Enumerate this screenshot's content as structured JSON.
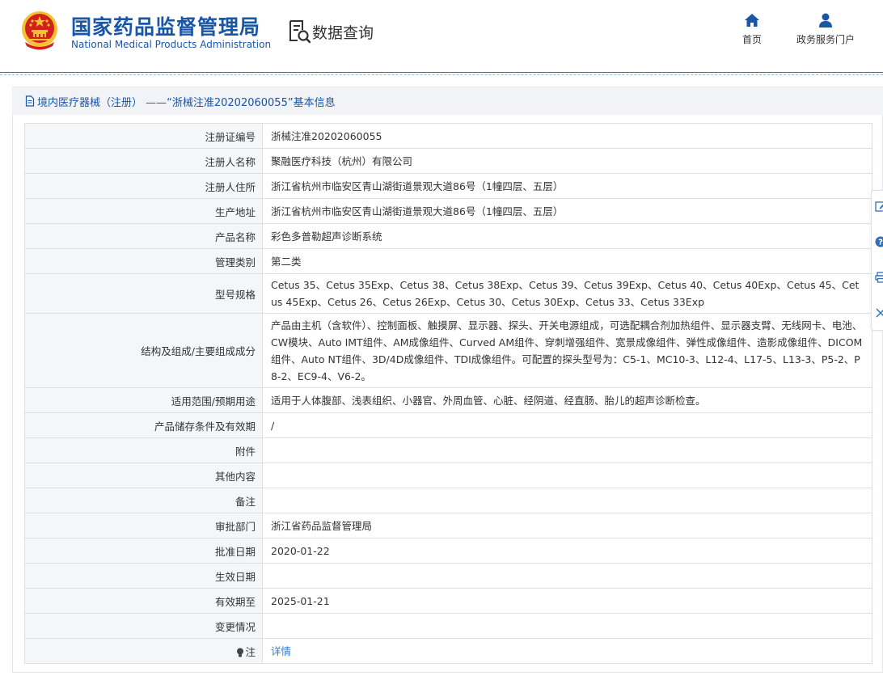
{
  "header": {
    "brand_cn": "国家药品监督管理局",
    "brand_en": "National Medical Products Administration",
    "query_label": "数据查询",
    "nav": [
      {
        "label": "首页",
        "icon": "home-icon"
      },
      {
        "label": "政务服务门户",
        "icon": "user-icon"
      }
    ]
  },
  "title_bar": {
    "text": "境内医疗器械（注册） ——“浙械注准20202060055”基本信息",
    "icon": "document-icon"
  },
  "fields": [
    {
      "label": "注册证编号",
      "value": "浙械注准20202060055"
    },
    {
      "label": "注册人名称",
      "value": "聚融医疗科技（杭州）有限公司"
    },
    {
      "label": "注册人住所",
      "value": "浙江省杭州市临安区青山湖街道景观大道86号（1幢四层、五层）"
    },
    {
      "label": "生产地址",
      "value": "浙江省杭州市临安区青山湖街道景观大道86号（1幢四层、五层）"
    },
    {
      "label": "产品名称",
      "value": "彩色多普勒超声诊断系统"
    },
    {
      "label": "管理类别",
      "value": "第二类"
    },
    {
      "label": "型号规格",
      "value": "Cetus 35、Cetus 35Exp、Cetus 38、Cetus 38Exp、Cetus 39、Cetus 39Exp、Cetus 40、Cetus 40Exp、Cetus 45、Cetus 45Exp、Cetus 26、Cetus 26Exp、Cetus 30、Cetus 30Exp、Cetus 33、Cetus 33Exp"
    },
    {
      "label": "结构及组成/主要组成成分",
      "value": "产品由主机（含软件）、控制面板、触摸屏、显示器、探头、开关电源组成，可选配耦合剂加热组件、显示器支臂、无线网卡、电池、CW模块、Auto IMT组件、AM成像组件、Curved AM组件、穿刺增强组件、宽景成像组件、弹性成像组件、造影成像组件、DICOM组件、Auto NT组件、3D/4D成像组件、TDI成像组件。可配置的探头型号为：C5-1、MC10-3、L12-4、L17-5、L13-3、P5-2、P8-2、EC9-4、V6-2。"
    },
    {
      "label": "适用范围/预期用途",
      "value": "适用于人体腹部、浅表组织、小器官、外周血管、心脏、经阴道、经直肠、胎儿的超声诊断检查。"
    },
    {
      "label": "产品储存条件及有效期",
      "value": "/"
    },
    {
      "label": "附件",
      "value": ""
    },
    {
      "label": "其他内容",
      "value": ""
    },
    {
      "label": "备注",
      "value": ""
    },
    {
      "label": "审批部门",
      "value": "浙江省药品监督管理局"
    },
    {
      "label": "批准日期",
      "value": "2020-01-22"
    },
    {
      "label": "生效日期",
      "value": ""
    },
    {
      "label": "有效期至",
      "value": "2025-01-21"
    },
    {
      "label": "变更情况",
      "value": ""
    }
  ],
  "note_row": {
    "label": "注",
    "link": "详情",
    "icon": "lightbulb-icon"
  },
  "side_tools": [
    "edit-icon",
    "help-icon",
    "print-icon",
    "close-icon"
  ],
  "colors": {
    "brand": "#1a56a6",
    "link": "#2f7bd4",
    "label_bg": "#f5f6f8",
    "title_bg": "#f1f3f6",
    "emblem_red": "#d2201b",
    "emblem_gold": "#f2c230"
  }
}
